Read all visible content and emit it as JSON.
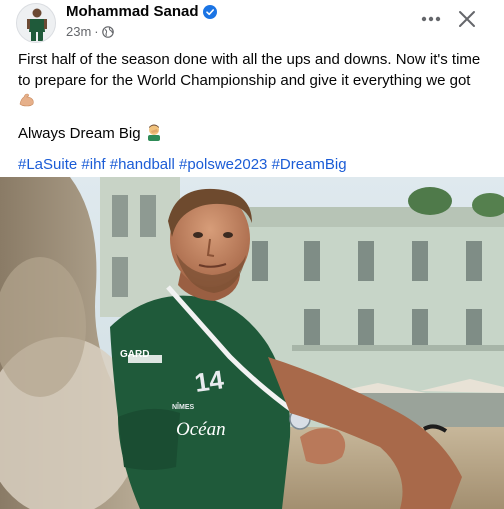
{
  "post": {
    "author": "Mohammad Sanad",
    "timestamp": "23m",
    "verified": true,
    "privacy_icon": "globe-icon",
    "menu_icon": "more-horizontal-icon",
    "close_icon": "close-icon",
    "text_line1": "First half of the season done with all the ups and downs. Now it's time to prepare for the World Championship and give it everything we got",
    "emoji1": "flexed-biceps",
    "text_line2": "Always Dream Big",
    "emoji2": "man-facepalming",
    "hashtags": [
      "#LaSuite",
      "#ihf",
      "#handball",
      "#polswe2023",
      "#DreamBig"
    ]
  },
  "photo": {
    "description_icon": "post-photo",
    "jersey_text": "Océan",
    "jersey_sponsor": "GARD",
    "jersey_number": "14",
    "jersey_city": "NÎMES"
  },
  "colors": {
    "link": "#1b5cd6",
    "verified": "#1b74e4",
    "secondary": "#65676b",
    "jersey": "#1f5a3a"
  }
}
